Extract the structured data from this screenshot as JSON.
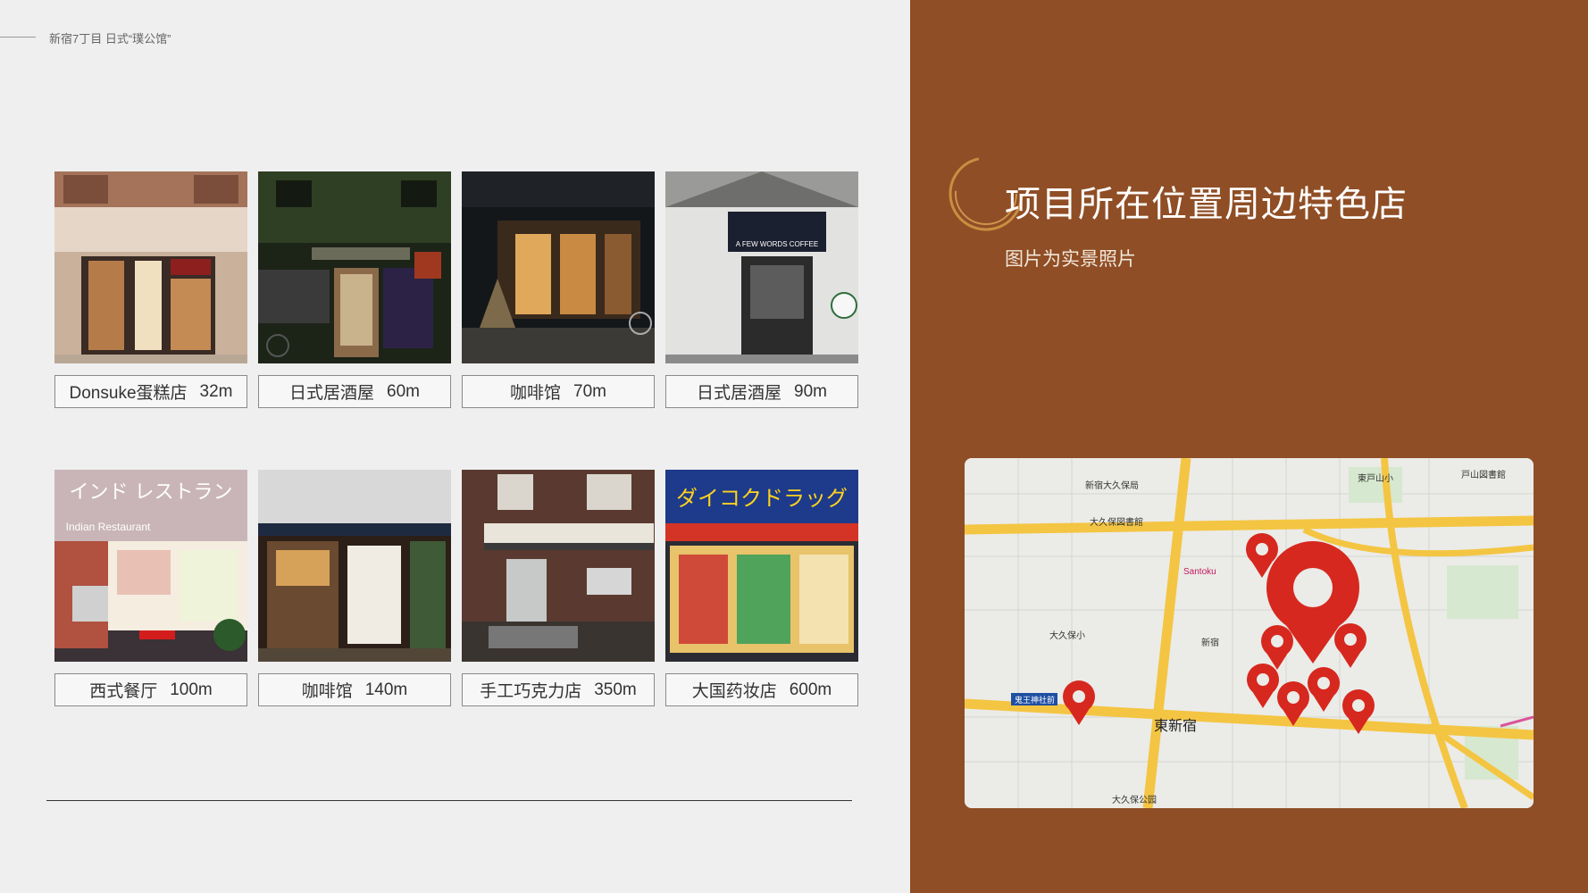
{
  "header": {
    "title": "新宿7丁目 日式“璞公馆”"
  },
  "page": {
    "title": "项目所在位置周边特色店",
    "subtitle": "图片为实景照片"
  },
  "shops": [
    {
      "name": "Donsuke蛋糕店",
      "distance": "32m"
    },
    {
      "name": "日式居酒屋",
      "distance": "60m"
    },
    {
      "name": "咖啡馆",
      "distance": "70m"
    },
    {
      "name": "日式居酒屋",
      "distance": "90m"
    },
    {
      "name": "西式餐厅",
      "distance": "100m"
    },
    {
      "name": "咖啡馆",
      "distance": "140m"
    },
    {
      "name": "手工巧克力店",
      "distance": "350m"
    },
    {
      "name": "大国药妆店",
      "distance": "600m"
    }
  ],
  "photo_signs": {
    "coffee": "A FEW WORDS COFFEE",
    "indian_jp": "インド レストラン",
    "indian_en": "Indian Restaurant",
    "drug": "ダイコクドラッグ"
  },
  "map": {
    "labels": {
      "station": "東新宿",
      "santoku": "Santoku",
      "okubo_park": "大久保公园",
      "shinjuku": "新宿",
      "okubo_library": "大久保図書館",
      "okubo_post": "新宿大久保局",
      "kiosk": "鬼王神社前",
      "higashi_toyama": "東戸山小",
      "toyama_library": "戸山図書館",
      "okubo": "大久保小"
    }
  },
  "colors": {
    "panel": "#8f4e25",
    "pin": "#d6281e",
    "road": "#f4c542"
  }
}
